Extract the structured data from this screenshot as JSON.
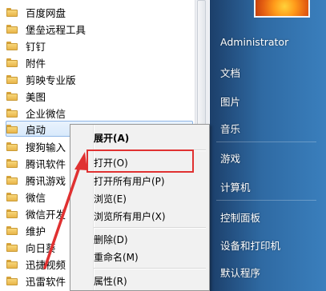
{
  "programs": [
    {
      "label": "百度网盘"
    },
    {
      "label": "堡垒远程工具"
    },
    {
      "label": "钉钉"
    },
    {
      "label": "附件"
    },
    {
      "label": "剪映专业版"
    },
    {
      "label": "美图"
    },
    {
      "label": "企业微信"
    },
    {
      "label": "启动"
    },
    {
      "label": "搜狗输入"
    },
    {
      "label": "腾讯软件"
    },
    {
      "label": "腾讯游戏"
    },
    {
      "label": "微信"
    },
    {
      "label": "微信开发"
    },
    {
      "label": "维护"
    },
    {
      "label": "向日葵"
    },
    {
      "label": "迅捷视频"
    },
    {
      "label": "迅雷软件"
    }
  ],
  "user": {
    "name": "Administrator"
  },
  "right_menu": [
    "文档",
    "图片",
    "音乐",
    "游戏",
    "计算机",
    "控制面板",
    "设备和打印机",
    "默认程序"
  ],
  "context_menu": {
    "expand": "展开(A)",
    "open": "打开(O)",
    "open_all": "打开所有用户(P)",
    "browse": "浏览(E)",
    "browse_all": "浏览所有用户(X)",
    "delete": "删除(D)",
    "rename": "重命名(M)",
    "properties": "属性(R)"
  },
  "colors": {
    "annotation": "#e03131",
    "right_pane": "#2f6aa3"
  }
}
